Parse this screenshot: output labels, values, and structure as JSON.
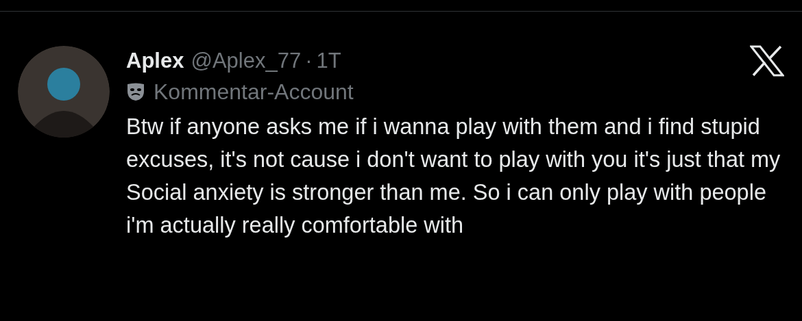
{
  "post": {
    "author_name": "Aplex",
    "handle": "@Aplex_77",
    "separator": "·",
    "time": "1T",
    "account_label": "Kommentar-Account",
    "text": "Btw if anyone asks me if i wanna play with them and i find stupid excuses, it's not cause i don't want to play with you it's just that my Social anxiety is stronger than me. So i can only play with people i'm actually really comfortable with"
  }
}
